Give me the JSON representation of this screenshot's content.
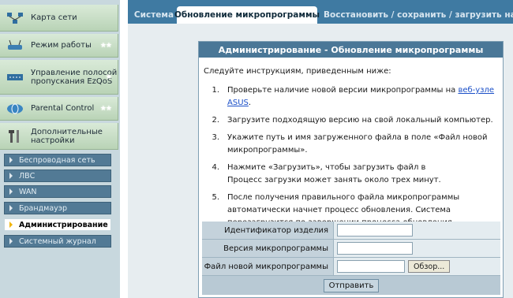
{
  "sidebar": {
    "main_items": [
      {
        "label": "Карта сети",
        "icon": "network-map-icon",
        "star": ""
      },
      {
        "label": "Режим работы",
        "icon": "router-icon",
        "star": "★★"
      },
      {
        "label": "Управление полосой пропускания EzQoS",
        "icon": "qos-icon",
        "star": "★"
      },
      {
        "label": "Parental Control",
        "icon": "globe-icon",
        "star": "★★"
      },
      {
        "label": "Дополнительные настройки",
        "icon": "tools-icon",
        "star": ""
      }
    ],
    "sub_items": [
      {
        "label": "Беспроводная сеть",
        "active": false
      },
      {
        "label": "ЛВС",
        "active": false
      },
      {
        "label": "WAN",
        "active": false
      },
      {
        "label": "Брандмауэр",
        "active": false
      },
      {
        "label": "Администрирование",
        "active": true
      },
      {
        "label": "Системный журнал",
        "active": false
      }
    ]
  },
  "tabs": [
    {
      "label": "Система",
      "active": false
    },
    {
      "label": "Обновление микропрограммы",
      "active": true
    },
    {
      "label": "Восстановить / сохранить / загрузить настр",
      "active": false
    }
  ],
  "panel": {
    "title": "Администрирование - Обновление микропрограммы",
    "intro": "Следуйте инструкциям, приведенным ниже:",
    "steps": [
      {
        "num": "1.",
        "text": "Проверьте наличие новой версии микропрограммы на ",
        "link": "веб-узле ASUS",
        "after": "."
      },
      {
        "num": "2.",
        "text": "Загрузите подходящую версию на свой локальный компьютер."
      },
      {
        "num": "3.",
        "text": "Укажите путь и имя загруженного файла в поле «Файл новой микропрограммы»."
      },
      {
        "num": "4.",
        "text": "Нажмите «Загрузить», чтобы загрузить файл в                Процесс загрузки может занять около трех минут."
      },
      {
        "num": "5.",
        "text": "После получения правильного файла микропрограммы автоматически начнет процесс обновления. Система перезагрузится по завершении процесса обновления."
      }
    ]
  },
  "form": {
    "product_id_label": "Идентификатор изделия",
    "product_id_value": "",
    "firmware_version_label": "Версия микропрограммы",
    "firmware_version_value": "",
    "new_firmware_label": "Файл новой микропрограммы",
    "new_firmware_value": "",
    "browse_label": "Обзор...",
    "submit_label": "Отправить"
  },
  "colors": {
    "tab_bar": "#3f7aa2",
    "panel_title": "#4a7797",
    "sub_item": "#527a95",
    "main_item": "#c9e0c6"
  }
}
